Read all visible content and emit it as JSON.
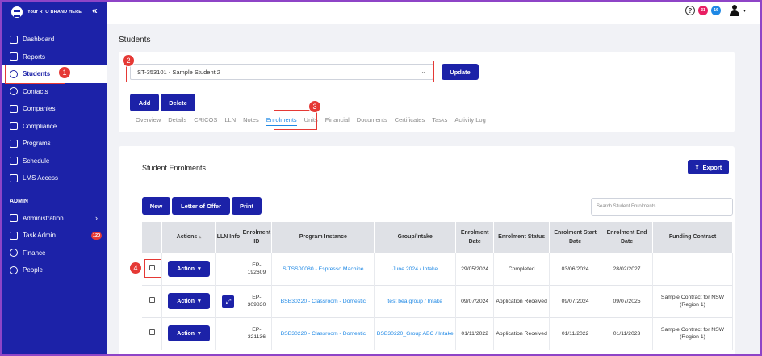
{
  "sidebar": {
    "brand": "Your RTO BRAND HERE",
    "collapse_icon": "«",
    "items": [
      {
        "label": "Dashboard",
        "icon": "chart-line-icon"
      },
      {
        "label": "Reports",
        "icon": "report-icon"
      },
      {
        "label": "Students",
        "icon": "users-icon"
      },
      {
        "label": "Contacts",
        "icon": "contacts-icon"
      },
      {
        "label": "Companies",
        "icon": "building-icon"
      },
      {
        "label": "Compliance",
        "icon": "compliance-icon"
      },
      {
        "label": "Programs",
        "icon": "programs-icon"
      },
      {
        "label": "Schedule",
        "icon": "calendar-icon"
      },
      {
        "label": "LMS Access",
        "icon": "lms-icon"
      }
    ],
    "admin_title": "ADMIN",
    "admin_items": [
      {
        "label": "Administration",
        "icon": "monitor-icon"
      },
      {
        "label": "Task Admin",
        "icon": "list-icon",
        "badge": "120"
      },
      {
        "label": "Finance",
        "icon": "finance-icon"
      },
      {
        "label": "People",
        "icon": "people-icon"
      }
    ]
  },
  "topbar": {
    "help": "?",
    "badge1": "31",
    "badge2": "16",
    "badge1_color": "#e91e63",
    "badge2_color": "#1e88e5",
    "caret": "▾"
  },
  "page": {
    "title": "Students"
  },
  "student": {
    "selected": "ST-353101 - Sample Student 2",
    "arrow": "⌄",
    "update": "Update",
    "add": "Add",
    "delete": "Delete",
    "tabs": [
      "Overview",
      "Details",
      "CRICOS",
      "LLN",
      "Notes",
      "Enrolments",
      "Units",
      "Financial",
      "Documents",
      "Certificates",
      "Tasks",
      "Activity Log"
    ]
  },
  "enrolments": {
    "title": "Student Enrolments",
    "export": "Export",
    "new": "New",
    "letter": "Letter of Offer",
    "print": "Print",
    "search_placeholder": "Search Student Enrolments...",
    "headers": [
      "",
      "Actions",
      "LLN Info",
      "Enrolment ID",
      "Program Instance",
      "Group/Intake",
      "Enrolment Date",
      "Enrolment Status",
      "Enrolment Start Date",
      "Enrolment End Date",
      "Funding Contract"
    ],
    "action_label": "Action",
    "action_caret": "▾",
    "rows": [
      {
        "id": "EP-192609",
        "program": "SITSS00080 - Espresso Machine",
        "group": "June 2024 / Intake",
        "date": "29/05/2024",
        "status": "Completed",
        "start": "03/06/2024",
        "end": "28/02/2027",
        "funding": "",
        "lln": false
      },
      {
        "id": "EP-309830",
        "program": "BSB30220 - Classroom - Domestic",
        "group": "test bea group / Intake",
        "date": "09/07/2024",
        "status": "Application Received",
        "start": "09/07/2024",
        "end": "09/07/2025",
        "funding": "Sample Contract for NSW (Region 1)",
        "lln": true
      },
      {
        "id": "EP-321136",
        "program": "BSB30220 - Classroom - Domestic",
        "group": "BSB30220_Group ABC / Intake",
        "date": "01/11/2022",
        "status": "Application Received",
        "start": "01/11/2022",
        "end": "01/11/2023",
        "funding": "Sample Contract for NSW (Region 1)",
        "lln": false
      }
    ]
  },
  "callouts": [
    "1",
    "2",
    "3",
    "4"
  ]
}
